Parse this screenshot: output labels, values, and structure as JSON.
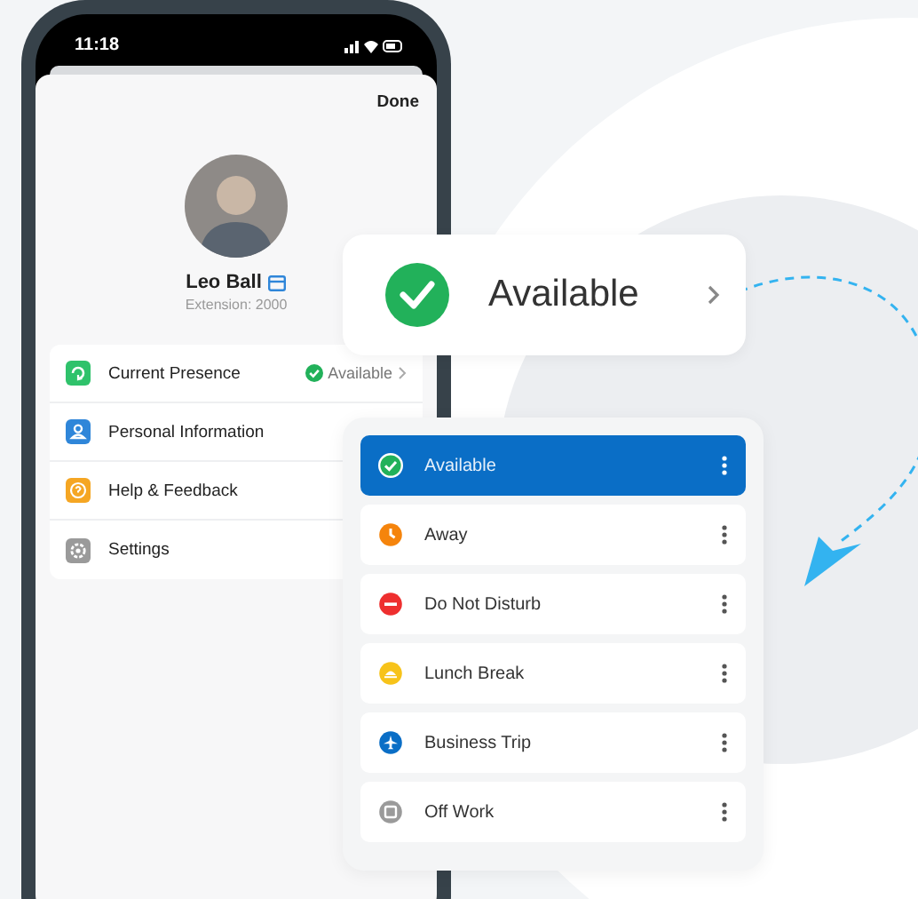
{
  "status_bar": {
    "time": "11:18"
  },
  "sheet": {
    "done_button": "Done"
  },
  "profile": {
    "name": "Leo Ball",
    "extension": "Extension: 2000"
  },
  "menu": [
    {
      "kind": "presence",
      "label": "Current Presence",
      "value": "Available",
      "color": "#2fc26b"
    },
    {
      "kind": "person",
      "label": "Personal Information",
      "color": "#2f86d9"
    },
    {
      "kind": "help",
      "label": "Help & Feedback",
      "color": "#f5a623"
    },
    {
      "kind": "settings",
      "label": "Settings",
      "color": "#9a9a9a"
    }
  ],
  "presence_card": {
    "label": "Available"
  },
  "statuses": [
    {
      "kind": "check",
      "label": "Available",
      "color": "#22b15a",
      "selected": true
    },
    {
      "kind": "clock",
      "label": "Away",
      "color": "#f5840c",
      "selected": false
    },
    {
      "kind": "minus",
      "label": "Do Not Disturb",
      "color": "#ee2f2f",
      "selected": false
    },
    {
      "kind": "lunch",
      "label": "Lunch Break",
      "color": "#f7c31a",
      "selected": false
    },
    {
      "kind": "plane",
      "label": "Business Trip",
      "color": "#0a6ec6",
      "selected": false
    },
    {
      "kind": "off",
      "label": "Off Work",
      "color": "#9a9a9a",
      "selected": false
    }
  ]
}
